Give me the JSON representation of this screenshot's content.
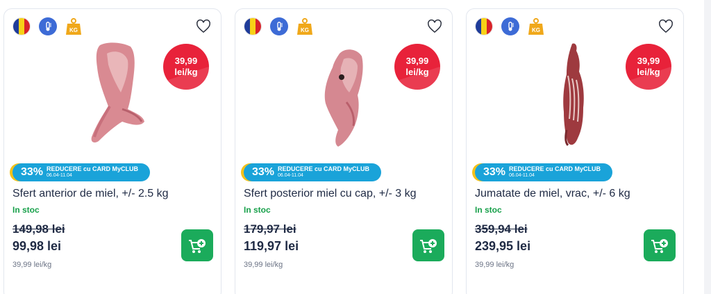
{
  "colors": {
    "badge_red": "#e8223a",
    "promo_blue": "#1aa3d9",
    "promo_yellow": "#f4c21a",
    "stock_green": "#17a04a",
    "cart_green": "#1bab5b"
  },
  "icons": [
    "romania-flag-icon",
    "thermometer-icon",
    "weight-kg-icon",
    "heart-icon",
    "add-to-cart-icon"
  ],
  "products": [
    {
      "badge_price": "39,99",
      "badge_unit": "lei/kg",
      "discount_pct": "33%",
      "discount_label": "REDUCERE cu CARD MyCLUB",
      "discount_dates": "06.04-11.04",
      "title": "Sfert anterior de miel, +/- 2.5 kg",
      "stock": "In stoc",
      "old_price": "149,98 lei",
      "new_price": "99,98 lei",
      "unit_price": "39,99 lei/kg",
      "kg_label": "KG"
    },
    {
      "badge_price": "39,99",
      "badge_unit": "lei/kg",
      "discount_pct": "33%",
      "discount_label": "REDUCERE cu CARD MyCLUB",
      "discount_dates": "06.04-11.04",
      "title": "Sfert posterior miel cu cap, +/- 3 kg",
      "stock": "In stoc",
      "old_price": "179,97 lei",
      "new_price": "119,97 lei",
      "unit_price": "39,99 lei/kg",
      "kg_label": "KG"
    },
    {
      "badge_price": "39,99",
      "badge_unit": "lei/kg",
      "discount_pct": "33%",
      "discount_label": "REDUCERE cu CARD MyCLUB",
      "discount_dates": "06.04-11.04",
      "title": "Jumatate de miel, vrac, +/- 6 kg",
      "stock": "In stoc",
      "old_price": "359,94 lei",
      "new_price": "239,95 lei",
      "unit_price": "39,99 lei/kg",
      "kg_label": "KG"
    }
  ]
}
